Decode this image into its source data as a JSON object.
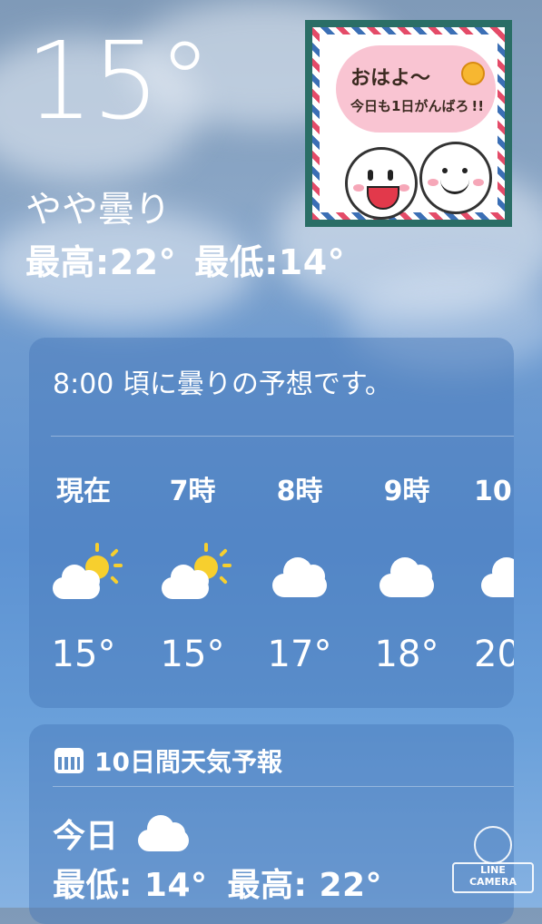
{
  "current": {
    "temperature": "15°",
    "condition": "やや曇り",
    "high": "最高:22°",
    "low": "最低:14°"
  },
  "sticker": {
    "line1": "おはよ〜",
    "line2": "今日も1日がんばろ !!"
  },
  "hourly": {
    "summary": "8:00 頃に曇りの予想です。",
    "hours": [
      {
        "label": "現在",
        "icon": "partly-sunny-icon",
        "temp": "15°"
      },
      {
        "label": "7時",
        "icon": "partly-sunny-icon",
        "temp": "15°"
      },
      {
        "label": "8時",
        "icon": "cloud-icon",
        "temp": "17°"
      },
      {
        "label": "9時",
        "icon": "cloud-icon",
        "temp": "18°"
      },
      {
        "label": "10",
        "icon": "cloud-icon",
        "temp": "20"
      }
    ]
  },
  "forecast": {
    "title": "10日間天気予報",
    "icon": "calendar-icon",
    "today": {
      "label": "今日",
      "icon": "cloud-icon",
      "low": "最低: 14°",
      "high": "最高: 22°"
    }
  },
  "watermark": {
    "line1": "LINE",
    "line2": "CAMERA"
  },
  "colors": {
    "sky_top": "#7f9ab8",
    "sky_bottom": "#86b2e2",
    "card": "#4678b9",
    "sun": "#f7cf2e",
    "sticker_border": "#2a6e66"
  }
}
